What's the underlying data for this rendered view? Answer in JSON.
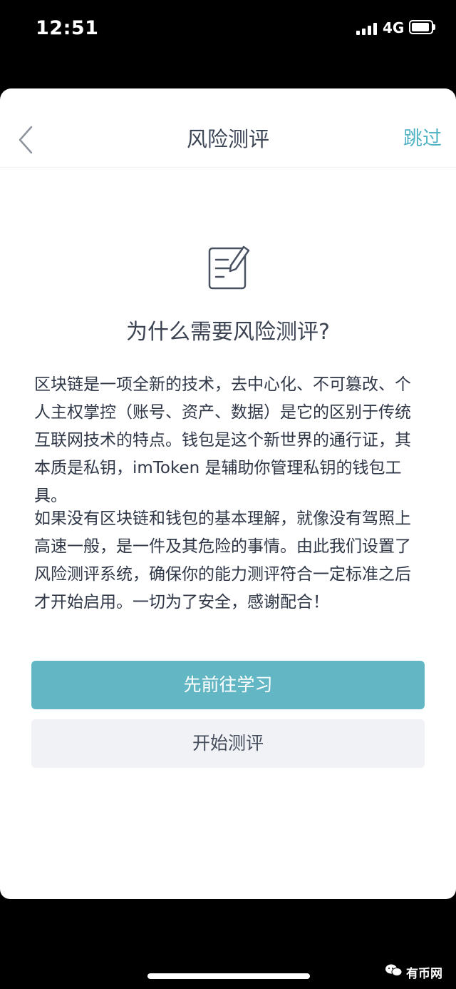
{
  "status_bar": {
    "time": "12:51",
    "network": "4G",
    "icons": [
      "signal-icon",
      "battery-icon"
    ]
  },
  "nav": {
    "title": "风险测评",
    "skip_label": "跳过",
    "back_icon": "chevron-left-icon"
  },
  "content": {
    "icon": "form-edit-icon",
    "heading": "为什么需要风险测评?",
    "paragraph1": "区块链是一项全新的技术，去中心化、不可篡改、个人主权掌控（账号、资产、数据）是它的区别于传统互联网技术的特点。钱包是这个新世界的通行证，其本质是私钥，imToken 是辅助你管理私钥的钱包工具。",
    "paragraph2": "如果没有区块链和钱包的基本理解，就像没有驾照上高速一般，是一件及其危险的事情。由此我们设置了风险测评系统，确保你的能力测评符合一定标准之后才开始启用。一切为了安全，感谢配合！"
  },
  "actions": {
    "learn_label": "先前往学习",
    "start_label": "开始测评"
  },
  "watermark": {
    "text": "有币网",
    "icon": "wechat-icon"
  },
  "colors": {
    "accent": "#4fb3c4",
    "primary_button": "#63b7c5",
    "secondary_button": "#f1f2f6",
    "text": "#2f3747"
  }
}
